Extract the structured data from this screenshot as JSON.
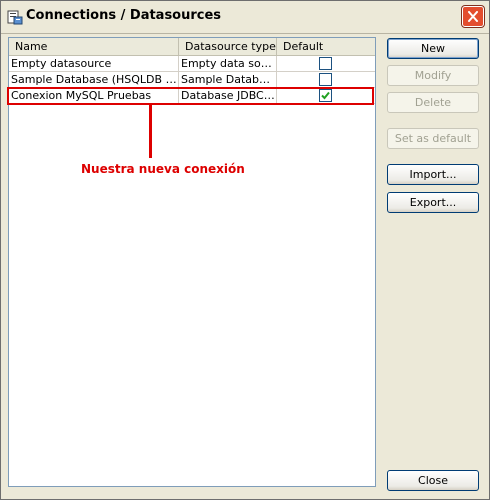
{
  "window": {
    "title": "Connections / Datasources",
    "icon": "report-app-icon",
    "close": "close-icon"
  },
  "table": {
    "columns": [
      "Name",
      "Datasource type",
      "Default"
    ],
    "rows": [
      {
        "name": "Empty datasource",
        "type": "Empty data source",
        "default": false
      },
      {
        "name": "Sample Database (HSQLDB test)",
        "type": "Sample Database…",
        "default": false
      },
      {
        "name": "Conexion MySQL Pruebas",
        "type": "Database JDBC c…",
        "default": true
      }
    ]
  },
  "annotation": {
    "text": "Nuestra nueva conexión",
    "color": "#dd0000"
  },
  "buttons": {
    "new": "New",
    "modify": "Modify",
    "delete": "Delete",
    "set_default": "Set as default",
    "import": "Import...",
    "export": "Export...",
    "close": "Close"
  },
  "colors": {
    "window_bg": "#ece9d8",
    "table_border": "#7f9db9",
    "header_bg": "#ebeadb",
    "checkbox_border": "#1c5180",
    "check_mark": "#21a121",
    "close_button": "#e34d2e"
  }
}
